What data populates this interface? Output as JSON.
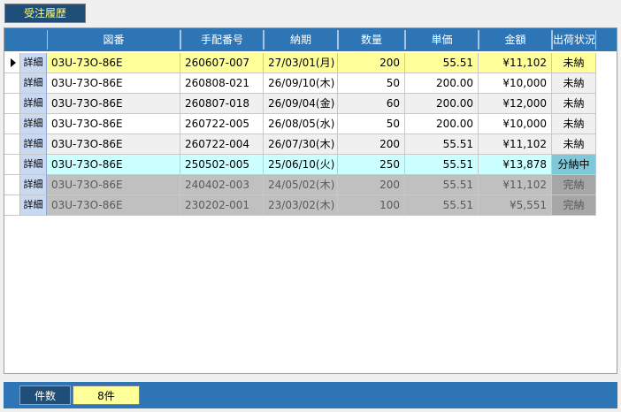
{
  "tab": {
    "label": "受注履歴"
  },
  "columns": [
    "図番",
    "手配番号",
    "納期",
    "数量",
    "単価",
    "金額",
    "出荷状況"
  ],
  "detail_label": "詳細",
  "rows": [
    {
      "drawing": "03U-73O-86E",
      "order": "260607-007",
      "due": "27/03/01(月)",
      "qty": "200",
      "unit": "55.51",
      "amount": "¥11,102",
      "status": "未納",
      "row_bg": "#ffff99",
      "status_bg": "#ffff99",
      "text": "#000000",
      "current": true
    },
    {
      "drawing": "03U-73O-86E",
      "order": "260808-021",
      "due": "26/09/10(木)",
      "qty": "50",
      "unit": "200.00",
      "amount": "¥10,000",
      "status": "未納",
      "row_bg": "#ffffff",
      "status_bg": "#f0f0f0",
      "text": "#000000"
    },
    {
      "drawing": "03U-73O-86E",
      "order": "260807-018",
      "due": "26/09/04(金)",
      "qty": "60",
      "unit": "200.00",
      "amount": "¥12,000",
      "status": "未納",
      "row_bg": "#f0f0f0",
      "status_bg": "#f0f0f0",
      "text": "#000000"
    },
    {
      "drawing": "03U-73O-86E",
      "order": "260722-005",
      "due": "26/08/05(水)",
      "qty": "50",
      "unit": "200.00",
      "amount": "¥10,000",
      "status": "未納",
      "row_bg": "#ffffff",
      "status_bg": "#f0f0f0",
      "text": "#000000"
    },
    {
      "drawing": "03U-73O-86E",
      "order": "260722-004",
      "due": "26/07/30(木)",
      "qty": "200",
      "unit": "55.51",
      "amount": "¥11,102",
      "status": "未納",
      "row_bg": "#f0f0f0",
      "status_bg": "#f0f0f0",
      "text": "#000000"
    },
    {
      "drawing": "03U-73O-86E",
      "order": "250502-005",
      "due": "25/06/10(火)",
      "qty": "250",
      "unit": "55.51",
      "amount": "¥13,878",
      "status": "分納中",
      "row_bg": "#ccffff",
      "status_bg": "#7fc8d9",
      "text": "#000000"
    },
    {
      "drawing": "03U-73O-86E",
      "order": "240402-003",
      "due": "24/05/02(木)",
      "qty": "200",
      "unit": "55.51",
      "amount": "¥11,102",
      "status": "完納",
      "row_bg": "#c0c0c0",
      "status_bg": "#a6a6a6",
      "text": "#595959"
    },
    {
      "drawing": "03U-73O-86E",
      "order": "230202-001",
      "due": "23/03/02(木)",
      "qty": "100",
      "unit": "55.51",
      "amount": "¥5,551",
      "status": "完納",
      "row_bg": "#c0c0c0",
      "status_bg": "#a6a6a6",
      "text": "#595959"
    }
  ],
  "footer": {
    "count_label": "件数",
    "count_value": "8件"
  },
  "colors": {
    "header_bg": "#2e75b6",
    "tab_bg": "#1f4e79",
    "tab_text": "#ffff66"
  }
}
